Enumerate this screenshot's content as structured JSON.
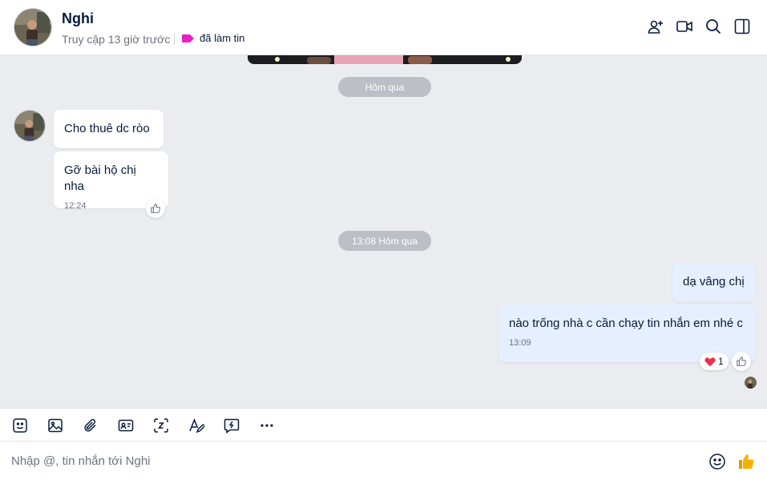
{
  "header": {
    "name": "Nghi",
    "status": "Truy cập 13 giờ trước",
    "tag_label": "đã làm tin",
    "tag_color": "#e91ec9",
    "actions": [
      "add-member-icon",
      "video-call-icon",
      "search-icon",
      "sidebar-toggle-icon"
    ]
  },
  "chat": {
    "date_pill_1": "Hôm qua",
    "date_pill_2": "13:08 Hôm qua",
    "incoming": {
      "msg1": "Cho thuê dc ròo",
      "msg2": "Gỡ bài hộ chị nha",
      "msg2_time": "12:24"
    },
    "outgoing": {
      "msg1": "dạ vâng chị",
      "msg2": "nào trống nhà c cần chạy tin nhắn em nhé c",
      "msg2_time": "13:09",
      "reaction_count": "1",
      "reaction_icon": "heart-icon"
    }
  },
  "toolbar": {
    "tools": [
      "sticker-icon",
      "image-icon",
      "attachment-icon",
      "contact-card-icon",
      "screenshot-icon",
      "text-format-icon",
      "quick-message-icon",
      "more-icon"
    ]
  },
  "composer": {
    "placeholder": "Nhập @, tin nhắn tới Nghi",
    "emoji_icon": "emoji-icon",
    "like_icon": "thumbs-up-icon"
  },
  "colors": {
    "accent": "#0068ff",
    "chat_bg": "#ebecf0",
    "outgoing_bubble": "#e5efff",
    "tag": "#e91ec9",
    "heart": "#e8344e",
    "like": "#f5b100"
  }
}
